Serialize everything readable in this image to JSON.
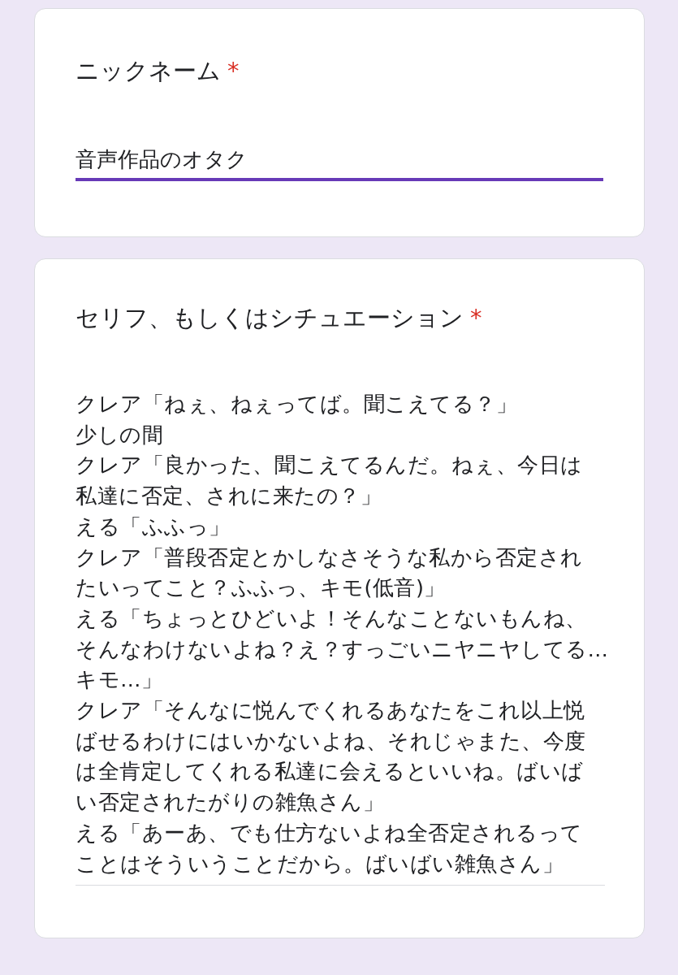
{
  "questions": [
    {
      "kind": "short",
      "title": "ニックネーム",
      "required_mark": "*",
      "value_lines": [
        "音声作品のオタク"
      ],
      "focused": true
    },
    {
      "kind": "paragraph",
      "title": "セリフ、もしくはシチュエーション",
      "required_mark": "*",
      "focused": false,
      "value_lines": [
        "クレア「ねぇ、ねぇってば。聞こえてる？」",
        "少しの間",
        "クレア「良かった、聞こえてるんだ。ねぇ、今日は",
        "私達に否定、されに来たの？」",
        "える「ふふっ」",
        "クレア「普段否定とかしなさそうな私から否定され",
        "たいってこと？ふふっ、キモ(低音)」",
        "える「ちょっとひどいよ！そんなことないもんね、",
        "そんなわけないよね？え？すっごいニヤニヤしてる…",
        "キモ…」",
        "クレア「そんなに悦んでくれるあなたをこれ以上悦",
        "ばせるわけにはいかないよね、それじゃまた、今度",
        "は全肯定してくれる私達に会えるといいね。ばいば",
        "い否定されたがりの雑魚さん」",
        "える「あーあ、でも仕方ないよね全否定されるって",
        "ことはそういうことだから。ばいばい雑魚さん」"
      ]
    }
  ]
}
